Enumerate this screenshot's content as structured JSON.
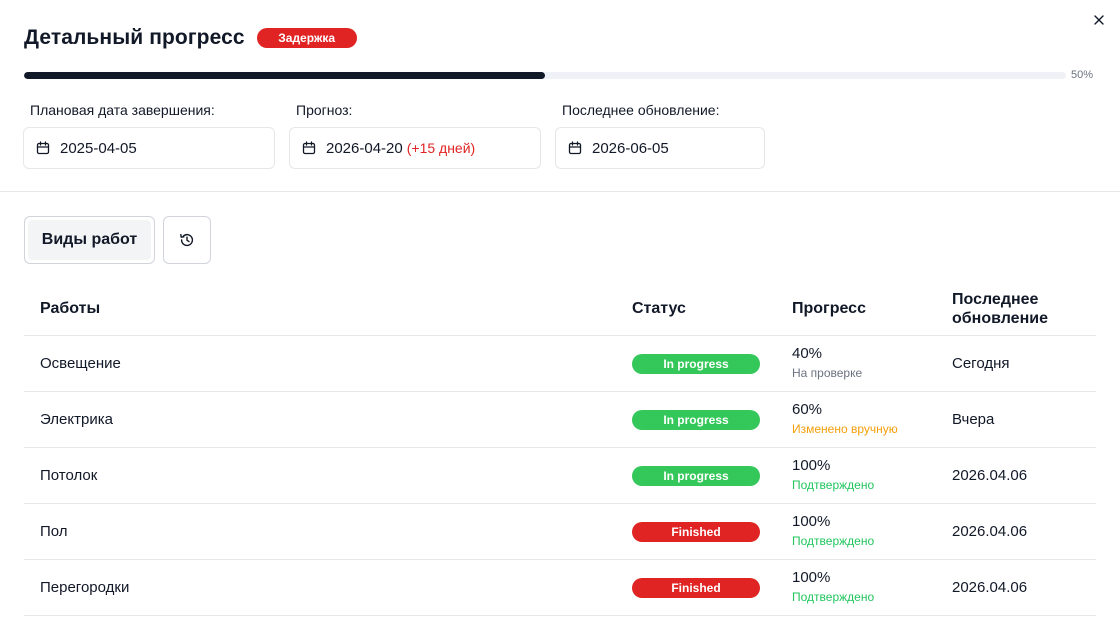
{
  "header": {
    "title": "Детальный прогресс",
    "badge": "Задержка",
    "progress_value": 50,
    "progress_label": "50%"
  },
  "fields": {
    "planned": {
      "label": "Плановая дата завершения:",
      "value": "2025-04-05"
    },
    "forecast": {
      "label": "Прогноз:",
      "value": "2026-04-20",
      "delta": "(+15 дней)"
    },
    "updated": {
      "label": "Последнее обновление:",
      "value": "2026-06-05"
    }
  },
  "tabs": {
    "work_types": "Виды работ"
  },
  "table": {
    "columns": [
      "Работы",
      "Статус",
      "Прогресс",
      "Последнее обновление"
    ],
    "rows": [
      {
        "name": "Освещение",
        "status": "In progress",
        "progress": "40%",
        "note": "На проверке",
        "updated": "Сегодня"
      },
      {
        "name": "Электрика",
        "status": "In progress",
        "progress": "60%",
        "note": "Изменено вручную",
        "updated": "Вчера"
      },
      {
        "name": "Потолок",
        "status": "In progress",
        "progress": "100%",
        "note": "Подтверждено",
        "updated": "2026.04.06"
      },
      {
        "name": "Пол",
        "status": "Finished",
        "progress": "100%",
        "note": "Подтверждено",
        "updated": "2026.04.06"
      },
      {
        "name": "Перегородки",
        "status": "Finished",
        "progress": "100%",
        "note": "Подтверждено",
        "updated": "2026.04.06"
      }
    ]
  },
  "colors": {
    "in_progress": "#34c759",
    "finished": "#e02424",
    "note_review": "#6b7280",
    "note_manual": "#f59e0b",
    "note_confirmed": "#22c55e"
  },
  "icons": [
    "close-icon",
    "calendar-icon",
    "history-icon"
  ]
}
